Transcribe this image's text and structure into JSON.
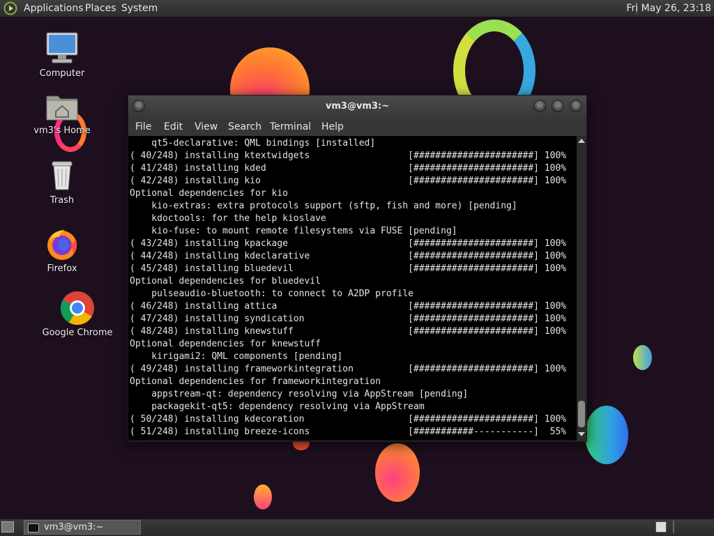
{
  "top_panel": {
    "menus": [
      "Applications",
      "Places",
      "System"
    ],
    "clock": "Fri May 26, 23:18"
  },
  "desktop_icons": [
    {
      "label": "Computer",
      "icon": "computer-icon"
    },
    {
      "label": "vm3's Home",
      "icon": "home-folder-icon"
    },
    {
      "label": "Trash",
      "icon": "trash-icon"
    },
    {
      "label": "Firefox",
      "icon": "firefox-icon"
    },
    {
      "label": "Google Chrome",
      "icon": "chrome-icon"
    }
  ],
  "terminal": {
    "title": "vm3@vm3:~",
    "menus": [
      "File",
      "Edit",
      "View",
      "Search",
      "Terminal",
      "Help"
    ],
    "lines": [
      "    qt5-declarative: QML bindings [installed]",
      "( 40/248) installing ktextwidgets                  [######################] 100%",
      "( 41/248) installing kded                          [######################] 100%",
      "( 42/248) installing kio                           [######################] 100%",
      "Optional dependencies for kio",
      "    kio-extras: extra protocols support (sftp, fish and more) [pending]",
      "    kdoctools: for the help kioslave",
      "    kio-fuse: to mount remote filesystems via FUSE [pending]",
      "( 43/248) installing kpackage                      [######################] 100%",
      "( 44/248) installing kdeclarative                  [######################] 100%",
      "( 45/248) installing bluedevil                     [######################] 100%",
      "Optional dependencies for bluedevil",
      "    pulseaudio-bluetooth: to connect to A2DP profile",
      "( 46/248) installing attica                        [######################] 100%",
      "( 47/248) installing syndication                   [######################] 100%",
      "( 48/248) installing knewstuff                     [######################] 100%",
      "Optional dependencies for knewstuff",
      "    kirigami2: QML components [pending]",
      "( 49/248) installing frameworkintegration          [######################] 100%",
      "Optional dependencies for frameworkintegration",
      "    appstream-qt: dependency resolving via AppStream [pending]",
      "    packagekit-qt5: dependency resolving via AppStream",
      "( 50/248) installing kdecoration                   [######################] 100%",
      "( 51/248) installing breeze-icons                  [###########-----------]  55%"
    ]
  },
  "taskbar": {
    "task_label": "vm3@vm3:~"
  },
  "colors": {
    "wallpaper": "#1e0f1e",
    "panel": "#333333",
    "terminal_bg": "#000000",
    "terminal_fg": "#e4e4e4"
  }
}
